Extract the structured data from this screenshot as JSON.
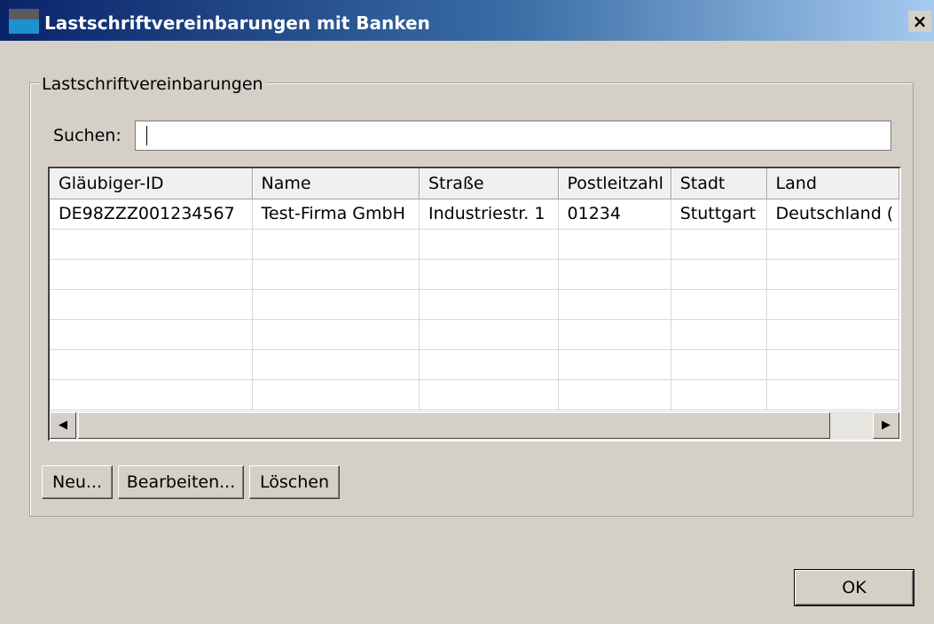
{
  "window": {
    "title": "Lastschriftvereinbarungen mit Banken",
    "close_label": "×"
  },
  "group": {
    "legend": "Lastschriftvereinbarungen"
  },
  "search": {
    "label": "Suchen:",
    "value": ""
  },
  "table": {
    "columns": [
      "Gläubiger-ID",
      "Name",
      "Straße",
      "Postleitzahl",
      "Stadt",
      "Land"
    ],
    "rows": [
      [
        "DE98ZZZ001234567",
        "Test-Firma GmbH",
        "Industriestr. 1",
        "01234",
        "Stuttgart",
        "Deutschland ("
      ]
    ]
  },
  "scrollbar": {
    "left_arrow": "◀",
    "right_arrow": "▶"
  },
  "buttons": {
    "new": "Neu...",
    "edit": "Bearbeiten...",
    "delete": "Löschen",
    "ok": "OK"
  }
}
